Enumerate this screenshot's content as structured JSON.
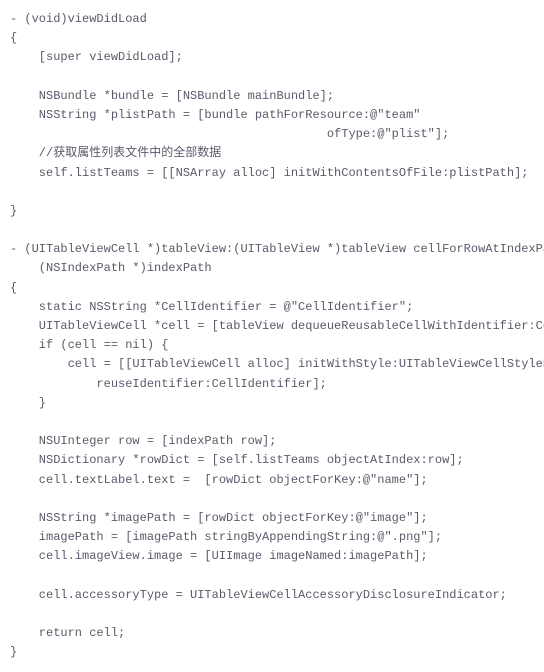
{
  "code": {
    "lines": [
      "- (void)viewDidLoad",
      "{",
      "    [super viewDidLoad];",
      "",
      "    NSBundle *bundle = [NSBundle mainBundle];",
      "    NSString *plistPath = [bundle pathForResource:@\"team\"",
      "                                            ofType:@\"plist\"];",
      "    //获取属性列表文件中的全部数据",
      "    self.listTeams = [[NSArray alloc] initWithContentsOfFile:plistPath];",
      "",
      "}",
      "",
      "- (UITableViewCell *)tableView:(UITableView *)tableView cellForRowAtIndexPath:",
      "    (NSIndexPath *)indexPath",
      "{",
      "    static NSString *CellIdentifier = @\"CellIdentifier\";",
      "    UITableViewCell *cell = [tableView dequeueReusableCellWithIdentifier:CellIdentifier];",
      "    if (cell == nil) {",
      "        cell = [[UITableViewCell alloc] initWithStyle:UITableViewCellStyleDefault",
      "            reuseIdentifier:CellIdentifier];",
      "    }",
      "",
      "    NSUInteger row = [indexPath row];",
      "    NSDictionary *rowDict = [self.listTeams objectAtIndex:row];",
      "    cell.textLabel.text =  [rowDict objectForKey:@\"name\"];",
      "",
      "    NSString *imagePath = [rowDict objectForKey:@\"image\"];",
      "    imagePath = [imagePath stringByAppendingString:@\".png\"];",
      "    cell.imageView.image = [UIImage imageNamed:imagePath];",
      "",
      "    cell.accessoryType = UITableViewCellAccessoryDisclosureIndicator;",
      "",
      "    return cell;",
      "}"
    ]
  }
}
